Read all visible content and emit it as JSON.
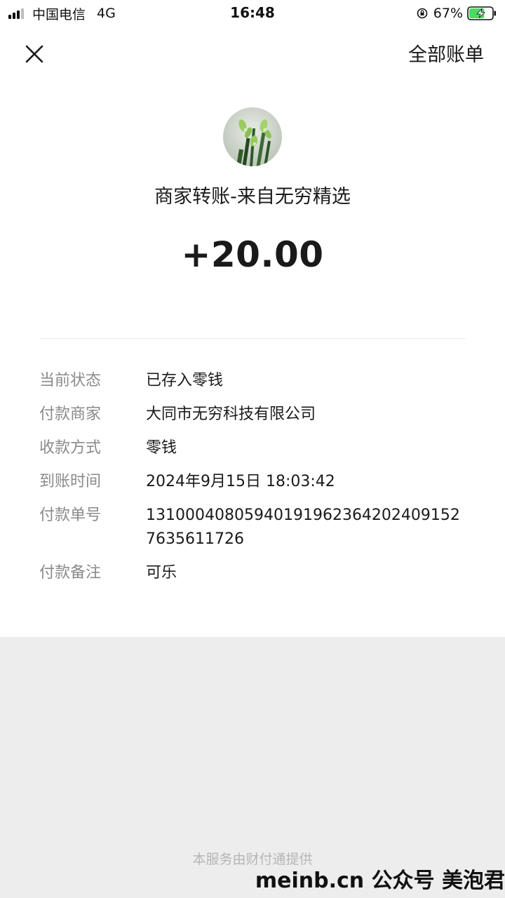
{
  "status_bar": {
    "carrier": "中国电信",
    "network": "4G",
    "time": "16:48",
    "battery_percent": "67%",
    "battery_level": 0.67,
    "battery_color": "#4cd964"
  },
  "header": {
    "close_icon": "close-icon",
    "all_bills_label": "全部账单"
  },
  "transaction": {
    "title": "商家转账-来自无穷精选",
    "amount": "+20.00"
  },
  "details": {
    "status": {
      "label": "当前状态",
      "value": "已存入零钱"
    },
    "merchant": {
      "label": "付款商家",
      "value": "大同市无穷科技有限公司"
    },
    "method": {
      "label": "收款方式",
      "value": "零钱"
    },
    "time": {
      "label": "到账时间",
      "value": "2024年9月15日 18:03:42"
    },
    "order_no": {
      "label": "付款单号",
      "value": "131000408059401919623642024091527635611726"
    },
    "remark": {
      "label": "付款备注",
      "value": "可乐"
    }
  },
  "footer": {
    "provider": "本服务由财付通提供",
    "watermark": "meinb.cn 公众号 美泡君"
  }
}
